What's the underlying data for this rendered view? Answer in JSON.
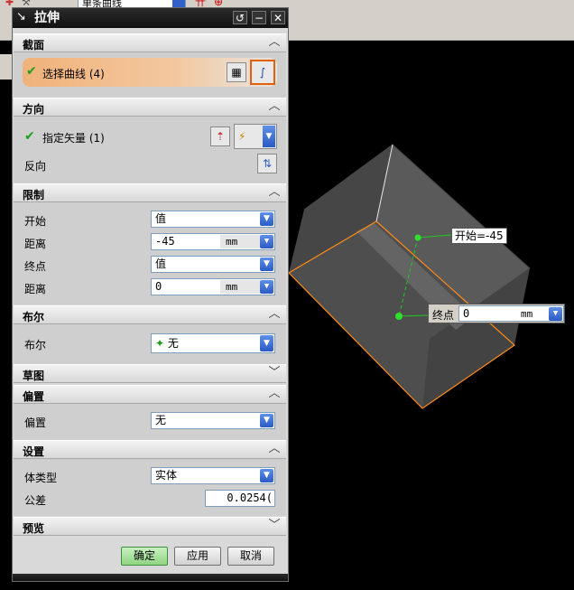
{
  "toolbar": {
    "curve_combo_value": "单条曲线"
  },
  "dialog": {
    "title": "拉伸",
    "section_section": {
      "header": "截面",
      "select_curve_label": "选择曲线 (4)"
    },
    "direction": {
      "header": "方向",
      "specify_vector_label": "指定矢量 (1)",
      "reverse_label": "反向"
    },
    "limits": {
      "header": "限制",
      "start_label": "开始",
      "start_value": "值",
      "start_distance_label": "距离",
      "start_distance_value": "-45",
      "start_distance_unit": "mm",
      "end_label": "终点",
      "end_value": "值",
      "end_distance_label": "距离",
      "end_distance_value": "0",
      "end_distance_unit": "mm"
    },
    "boolean": {
      "header": "布尔",
      "label": "布尔",
      "value": "无"
    },
    "sketch": {
      "header": "草图"
    },
    "offset": {
      "header": "偏置",
      "label": "偏置",
      "value": "无"
    },
    "settings": {
      "header": "设置",
      "body_type_label": "体类型",
      "body_type_value": "实体",
      "tolerance_label": "公差",
      "tolerance_value": "0.0254("
    },
    "preview": {
      "header": "预览"
    },
    "buttons": {
      "ok": "确定",
      "apply": "应用",
      "cancel": "取消"
    }
  },
  "viewport": {
    "start_annotation": "开始=-45",
    "end_label": "终点",
    "end_value": "0",
    "end_unit": "mm"
  },
  "colors": {
    "selected_row": "#f0b27a",
    "check_green": "#1aa01a",
    "dropdown_blue": "#2b5bc4",
    "edge_orange": "#ff8c1a",
    "ok_green": "#8fd483"
  }
}
